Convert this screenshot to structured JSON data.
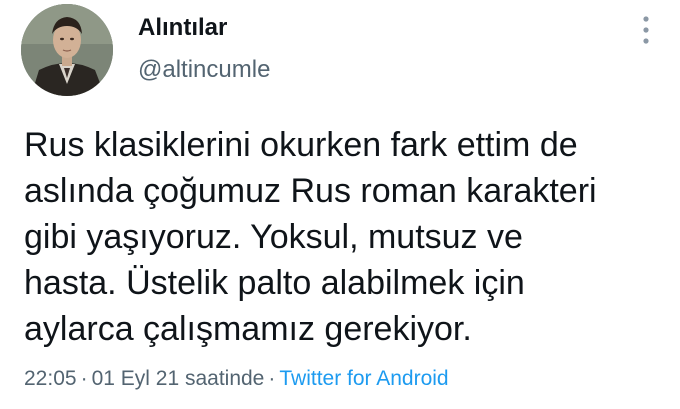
{
  "user": {
    "display_name": "Alıntılar",
    "handle": "@altincumle"
  },
  "tweet": {
    "lines": [
      "Rus klasiklerini okurken fark ettim de",
      "aslında çoğumuz Rus roman karakteri",
      "gibi yaşıyoruz. Yoksul, mutsuz ve",
      "hasta. Üstelik palto alabilmek için",
      "aylarca çalışmamız gerekiyor."
    ]
  },
  "meta": {
    "time": "22:05",
    "separator": "·",
    "date": "01 Eyl 21 saatinde",
    "source": "Twitter for Android"
  },
  "icons": {
    "more": "vertical-dots-icon",
    "avatar": "profile-photo"
  },
  "colors": {
    "text": "#0f1419",
    "secondary": "#536471",
    "link": "#1d9bf0"
  }
}
